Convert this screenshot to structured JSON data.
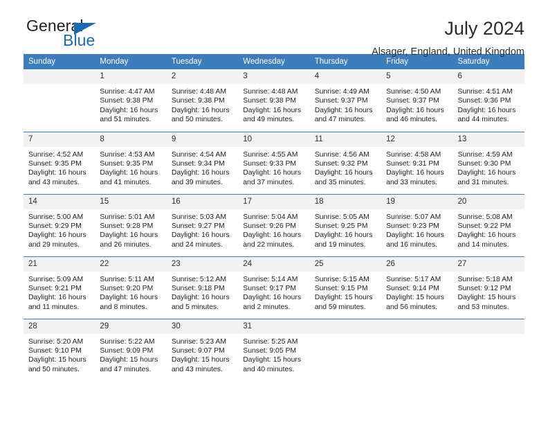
{
  "brand": {
    "word_one": "General",
    "word_two": "Blue",
    "triangle_icon": "triangle-icon",
    "accent_color": "#1a6bb5"
  },
  "header": {
    "title": "July 2024",
    "subtitle": "Alsager, England, United Kingdom"
  },
  "calendar": {
    "header_bg": "#3c7ebd",
    "daynum_bg": "#f2f2f2",
    "weekday_headers": [
      "Sunday",
      "Monday",
      "Tuesday",
      "Wednesday",
      "Thursday",
      "Friday",
      "Saturday"
    ],
    "weeks": [
      [
        {
          "blank": true,
          "day": ""
        },
        {
          "day": "1",
          "lines": [
            "Sunrise: 4:47 AM",
            "Sunset: 9:38 PM",
            "Daylight: 16 hours",
            "and 51 minutes."
          ]
        },
        {
          "day": "2",
          "lines": [
            "Sunrise: 4:48 AM",
            "Sunset: 9:38 PM",
            "Daylight: 16 hours",
            "and 50 minutes."
          ]
        },
        {
          "day": "3",
          "lines": [
            "Sunrise: 4:48 AM",
            "Sunset: 9:38 PM",
            "Daylight: 16 hours",
            "and 49 minutes."
          ]
        },
        {
          "day": "4",
          "lines": [
            "Sunrise: 4:49 AM",
            "Sunset: 9:37 PM",
            "Daylight: 16 hours",
            "and 47 minutes."
          ]
        },
        {
          "day": "5",
          "lines": [
            "Sunrise: 4:50 AM",
            "Sunset: 9:37 PM",
            "Daylight: 16 hours",
            "and 46 minutes."
          ]
        },
        {
          "day": "6",
          "lines": [
            "Sunrise: 4:51 AM",
            "Sunset: 9:36 PM",
            "Daylight: 16 hours",
            "and 44 minutes."
          ]
        }
      ],
      [
        {
          "day": "7",
          "lines": [
            "Sunrise: 4:52 AM",
            "Sunset: 9:35 PM",
            "Daylight: 16 hours",
            "and 43 minutes."
          ]
        },
        {
          "day": "8",
          "lines": [
            "Sunrise: 4:53 AM",
            "Sunset: 9:35 PM",
            "Daylight: 16 hours",
            "and 41 minutes."
          ]
        },
        {
          "day": "9",
          "lines": [
            "Sunrise: 4:54 AM",
            "Sunset: 9:34 PM",
            "Daylight: 16 hours",
            "and 39 minutes."
          ]
        },
        {
          "day": "10",
          "lines": [
            "Sunrise: 4:55 AM",
            "Sunset: 9:33 PM",
            "Daylight: 16 hours",
            "and 37 minutes."
          ]
        },
        {
          "day": "11",
          "lines": [
            "Sunrise: 4:56 AM",
            "Sunset: 9:32 PM",
            "Daylight: 16 hours",
            "and 35 minutes."
          ]
        },
        {
          "day": "12",
          "lines": [
            "Sunrise: 4:58 AM",
            "Sunset: 9:31 PM",
            "Daylight: 16 hours",
            "and 33 minutes."
          ]
        },
        {
          "day": "13",
          "lines": [
            "Sunrise: 4:59 AM",
            "Sunset: 9:30 PM",
            "Daylight: 16 hours",
            "and 31 minutes."
          ]
        }
      ],
      [
        {
          "day": "14",
          "lines": [
            "Sunrise: 5:00 AM",
            "Sunset: 9:29 PM",
            "Daylight: 16 hours",
            "and 29 minutes."
          ]
        },
        {
          "day": "15",
          "lines": [
            "Sunrise: 5:01 AM",
            "Sunset: 9:28 PM",
            "Daylight: 16 hours",
            "and 26 minutes."
          ]
        },
        {
          "day": "16",
          "lines": [
            "Sunrise: 5:03 AM",
            "Sunset: 9:27 PM",
            "Daylight: 16 hours",
            "and 24 minutes."
          ]
        },
        {
          "day": "17",
          "lines": [
            "Sunrise: 5:04 AM",
            "Sunset: 9:26 PM",
            "Daylight: 16 hours",
            "and 22 minutes."
          ]
        },
        {
          "day": "18",
          "lines": [
            "Sunrise: 5:05 AM",
            "Sunset: 9:25 PM",
            "Daylight: 16 hours",
            "and 19 minutes."
          ]
        },
        {
          "day": "19",
          "lines": [
            "Sunrise: 5:07 AM",
            "Sunset: 9:23 PM",
            "Daylight: 16 hours",
            "and 16 minutes."
          ]
        },
        {
          "day": "20",
          "lines": [
            "Sunrise: 5:08 AM",
            "Sunset: 9:22 PM",
            "Daylight: 16 hours",
            "and 14 minutes."
          ]
        }
      ],
      [
        {
          "day": "21",
          "lines": [
            "Sunrise: 5:09 AM",
            "Sunset: 9:21 PM",
            "Daylight: 16 hours",
            "and 11 minutes."
          ]
        },
        {
          "day": "22",
          "lines": [
            "Sunrise: 5:11 AM",
            "Sunset: 9:20 PM",
            "Daylight: 16 hours",
            "and 8 minutes."
          ]
        },
        {
          "day": "23",
          "lines": [
            "Sunrise: 5:12 AM",
            "Sunset: 9:18 PM",
            "Daylight: 16 hours",
            "and 5 minutes."
          ]
        },
        {
          "day": "24",
          "lines": [
            "Sunrise: 5:14 AM",
            "Sunset: 9:17 PM",
            "Daylight: 16 hours",
            "and 2 minutes."
          ]
        },
        {
          "day": "25",
          "lines": [
            "Sunrise: 5:15 AM",
            "Sunset: 9:15 PM",
            "Daylight: 15 hours",
            "and 59 minutes."
          ]
        },
        {
          "day": "26",
          "lines": [
            "Sunrise: 5:17 AM",
            "Sunset: 9:14 PM",
            "Daylight: 15 hours",
            "and 56 minutes."
          ]
        },
        {
          "day": "27",
          "lines": [
            "Sunrise: 5:18 AM",
            "Sunset: 9:12 PM",
            "Daylight: 15 hours",
            "and 53 minutes."
          ]
        }
      ],
      [
        {
          "day": "28",
          "lines": [
            "Sunrise: 5:20 AM",
            "Sunset: 9:10 PM",
            "Daylight: 15 hours",
            "and 50 minutes."
          ]
        },
        {
          "day": "29",
          "lines": [
            "Sunrise: 5:22 AM",
            "Sunset: 9:09 PM",
            "Daylight: 15 hours",
            "and 47 minutes."
          ]
        },
        {
          "day": "30",
          "lines": [
            "Sunrise: 5:23 AM",
            "Sunset: 9:07 PM",
            "Daylight: 15 hours",
            "and 43 minutes."
          ]
        },
        {
          "day": "31",
          "lines": [
            "Sunrise: 5:25 AM",
            "Sunset: 9:05 PM",
            "Daylight: 15 hours",
            "and 40 minutes."
          ]
        },
        {
          "blank": true,
          "day": ""
        },
        {
          "blank": true,
          "day": ""
        },
        {
          "blank": true,
          "day": ""
        }
      ]
    ]
  }
}
